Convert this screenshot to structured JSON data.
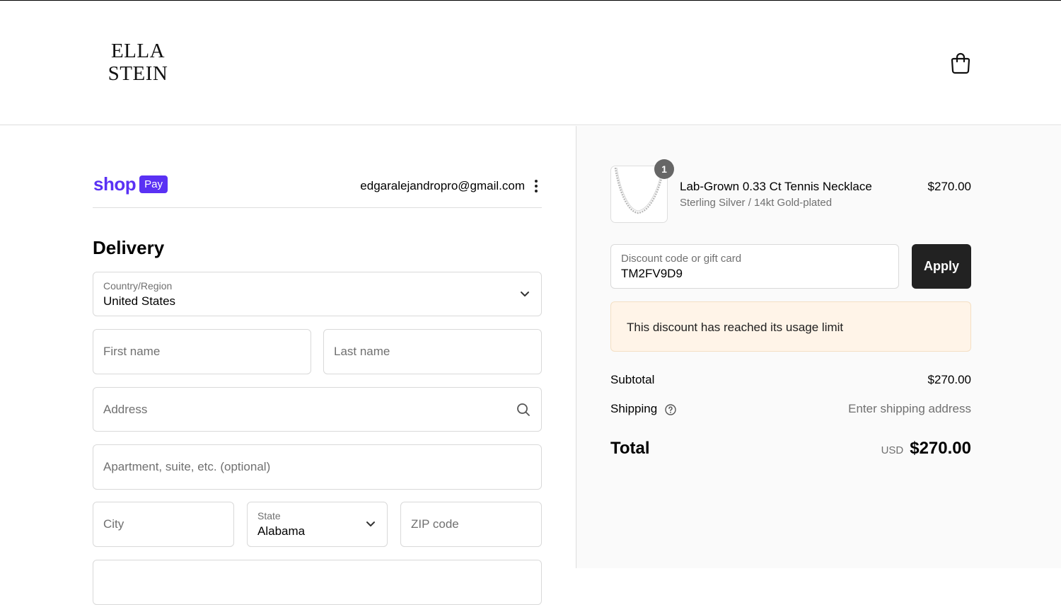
{
  "header": {
    "logo_line1": "ELLA",
    "logo_line2": "STEIN",
    "cart_icon": "shopping-bag-icon"
  },
  "account": {
    "shop_pay_word": "shop",
    "shop_pay_badge": "Pay",
    "email": "edgaralejandropro@gmail.com",
    "menu_icon": "kebab-menu-icon"
  },
  "delivery": {
    "heading": "Delivery",
    "country_label": "Country/Region",
    "country_value": "United States",
    "first_name_placeholder": "First name",
    "last_name_placeholder": "Last name",
    "address_placeholder": "Address",
    "apartment_placeholder": "Apartment, suite, etc. (optional)",
    "city_placeholder": "City",
    "state_label": "State",
    "state_value": "Alabama",
    "zip_placeholder": "ZIP code"
  },
  "summary": {
    "item": {
      "quantity": "1",
      "name": "Lab-Grown 0.33 Ct Tennis Necklace",
      "variant": "Sterling Silver / 14kt Gold-plated",
      "price": "$270.00"
    },
    "discount_label": "Discount code or gift card",
    "discount_value": "TM2FV9D9",
    "apply_label": "Apply",
    "notice": "This discount has reached its usage limit",
    "subtotal_label": "Subtotal",
    "subtotal_value": "$270.00",
    "shipping_label": "Shipping",
    "shipping_value": "Enter shipping address",
    "total_label": "Total",
    "total_currency": "USD",
    "total_value": "$270.00"
  },
  "colors": {
    "shop_pay_purple": "#5a31f4",
    "apply_button": "#222222",
    "notice_bg": "#fff4e8",
    "summary_bg": "#fafafa"
  }
}
